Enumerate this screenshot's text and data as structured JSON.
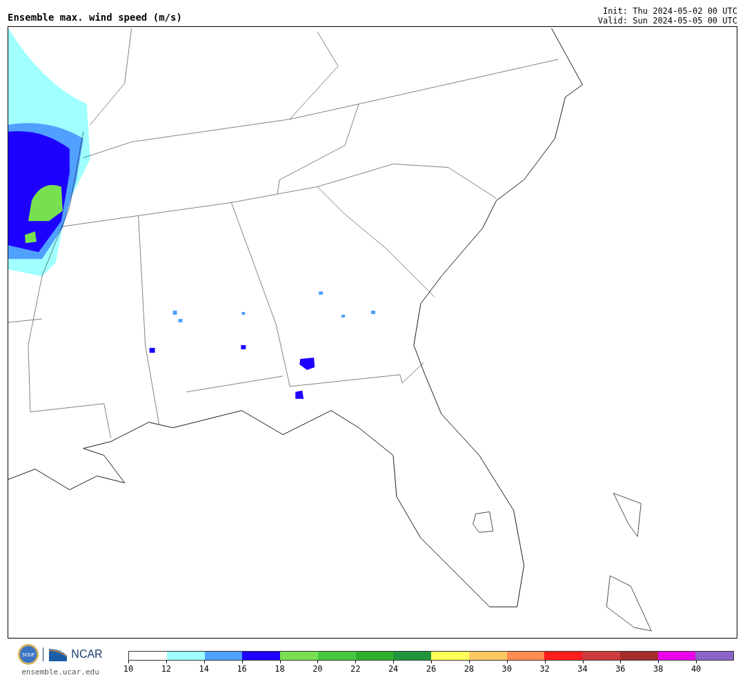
{
  "title": "Ensemble max. wind speed (m/s)",
  "init": "Init: Thu 2024-05-02 00 UTC",
  "valid": "Valid: Sun 2024-05-05 00 UTC",
  "logos": {
    "seal_text": "NSF",
    "org_text": "NCAR",
    "site": "ensemble.ucar.edu"
  },
  "legend": {
    "bins": [
      {
        "color": "#ffffff",
        "label": "10"
      },
      {
        "color": "#a0ffff",
        "label": "12"
      },
      {
        "color": "#50a0ff",
        "label": "14"
      },
      {
        "color": "#1e00ff",
        "label": "16"
      },
      {
        "color": "#78e050",
        "label": "18"
      },
      {
        "color": "#48c840",
        "label": "20"
      },
      {
        "color": "#30b030",
        "label": "22"
      },
      {
        "color": "#20963c",
        "label": "24"
      },
      {
        "color": "#ffff5a",
        "label": "26"
      },
      {
        "color": "#ffc864",
        "label": "28"
      },
      {
        "color": "#ff8c50",
        "label": "30"
      },
      {
        "color": "#ff1e1e",
        "label": "32"
      },
      {
        "color": "#cd3c3c",
        "label": "34"
      },
      {
        "color": "#a52d2d",
        "label": "36"
      },
      {
        "color": "#eb00eb",
        "label": "38"
      },
      {
        "color": "#8c64c8",
        "label": "40"
      }
    ]
  }
}
